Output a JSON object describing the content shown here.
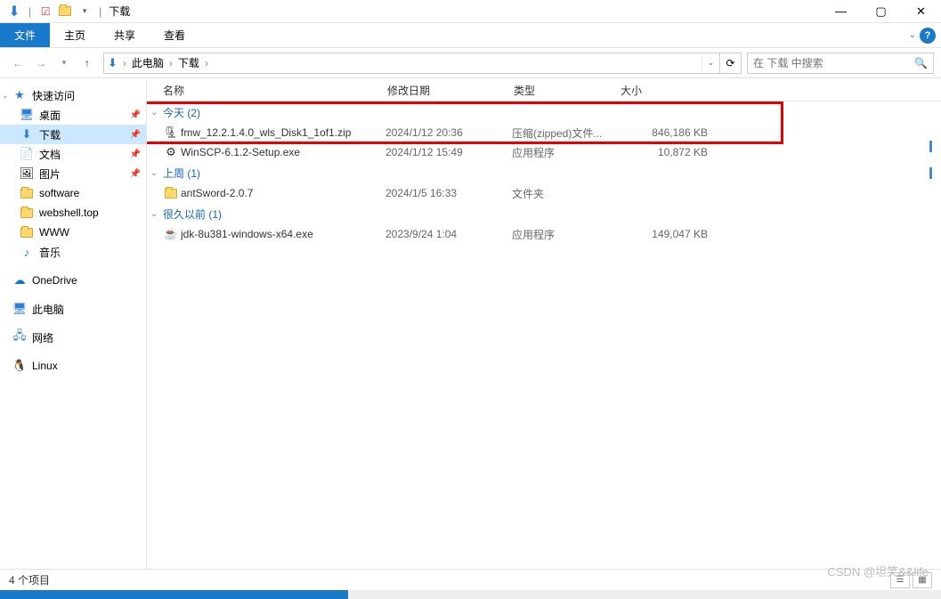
{
  "titlebar": {
    "title": "下载"
  },
  "ribbon": {
    "file": "文件",
    "home": "主页",
    "share": "共享",
    "view": "查看"
  },
  "breadcrumb": {
    "seg1": "此电脑",
    "seg2": "下载"
  },
  "search": {
    "placeholder": "在 下载 中搜索"
  },
  "navpane": {
    "quick_access": "快速访问",
    "desktop": "桌面",
    "downloads": "下载",
    "documents": "文档",
    "pictures": "图片",
    "software": "software",
    "webshell": "webshell.top",
    "www": "WWW",
    "music": "音乐",
    "onedrive": "OneDrive",
    "this_pc": "此电脑",
    "network": "网络",
    "linux": "Linux"
  },
  "columns": {
    "name": "名称",
    "date": "修改日期",
    "type": "类型",
    "size": "大小"
  },
  "groups": [
    {
      "label": "今天 (2)",
      "files": [
        {
          "name": "fmw_12.2.1.4.0_wls_Disk1_1of1.zip",
          "date": "2024/1/12 20:36",
          "type": "压缩(zipped)文件...",
          "size": "846,186 KB",
          "icon": "zip"
        },
        {
          "name": "WinSCP-6.1.2-Setup.exe",
          "date": "2024/1/12 15:49",
          "type": "应用程序",
          "size": "10,872 KB",
          "icon": "exe"
        }
      ]
    },
    {
      "label": "上周 (1)",
      "files": [
        {
          "name": "antSword-2.0.7",
          "date": "2024/1/5 16:33",
          "type": "文件夹",
          "size": "",
          "icon": "folder"
        }
      ]
    },
    {
      "label": "很久以前 (1)",
      "files": [
        {
          "name": "jdk-8u381-windows-x64.exe",
          "date": "2023/9/24 1:04",
          "type": "应用程序",
          "size": "149,047 KB",
          "icon": "java"
        }
      ]
    }
  ],
  "statusbar": {
    "count": "4 个项目"
  },
  "watermark": "CSDN @坦笑&&life"
}
